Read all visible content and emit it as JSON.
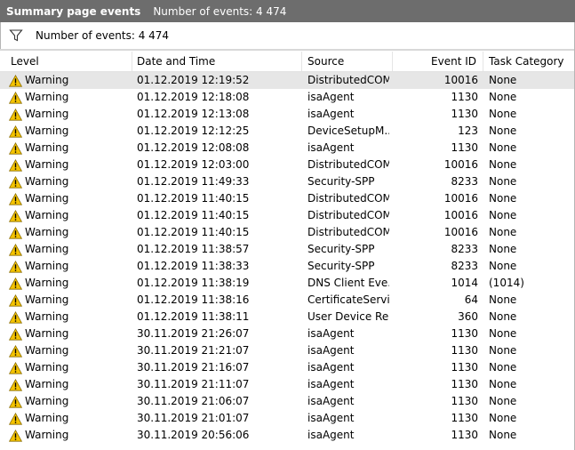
{
  "title": {
    "name": "Summary page events",
    "count": "Number of events: 4 474"
  },
  "filter": {
    "icon": "filter-icon",
    "text": "Number of events: 4 474"
  },
  "columns": {
    "level": "Level",
    "date": "Date and Time",
    "source": "Source",
    "event_id": "Event ID",
    "category": "Task Category"
  },
  "colors": {
    "titlebar": "#6d6d6d",
    "selected_row": "#e6e6e6",
    "warning_icon": "#f5c400"
  },
  "rows": [
    {
      "level": "Warning",
      "date": "01.12.2019 12:19:52",
      "source": "DistributedCOM",
      "event_id": "10016",
      "category": "None",
      "selected": true
    },
    {
      "level": "Warning",
      "date": "01.12.2019 12:18:08",
      "source": "isaAgent",
      "event_id": "1130",
      "category": "None"
    },
    {
      "level": "Warning",
      "date": "01.12.2019 12:13:08",
      "source": "isaAgent",
      "event_id": "1130",
      "category": "None"
    },
    {
      "level": "Warning",
      "date": "01.12.2019 12:12:25",
      "source": "DeviceSetupM...",
      "event_id": "123",
      "category": "None"
    },
    {
      "level": "Warning",
      "date": "01.12.2019 12:08:08",
      "source": "isaAgent",
      "event_id": "1130",
      "category": "None"
    },
    {
      "level": "Warning",
      "date": "01.12.2019 12:03:00",
      "source": "DistributedCOM",
      "event_id": "10016",
      "category": "None"
    },
    {
      "level": "Warning",
      "date": "01.12.2019 11:49:33",
      "source": "Security-SPP",
      "event_id": "8233",
      "category": "None"
    },
    {
      "level": "Warning",
      "date": "01.12.2019 11:40:15",
      "source": "DistributedCOM",
      "event_id": "10016",
      "category": "None"
    },
    {
      "level": "Warning",
      "date": "01.12.2019 11:40:15",
      "source": "DistributedCOM",
      "event_id": "10016",
      "category": "None"
    },
    {
      "level": "Warning",
      "date": "01.12.2019 11:40:15",
      "source": "DistributedCOM",
      "event_id": "10016",
      "category": "None"
    },
    {
      "level": "Warning",
      "date": "01.12.2019 11:38:57",
      "source": "Security-SPP",
      "event_id": "8233",
      "category": "None"
    },
    {
      "level": "Warning",
      "date": "01.12.2019 11:38:33",
      "source": "Security-SPP",
      "event_id": "8233",
      "category": "None"
    },
    {
      "level": "Warning",
      "date": "01.12.2019 11:38:19",
      "source": "DNS Client Eve...",
      "event_id": "1014",
      "category": "(1014)"
    },
    {
      "level": "Warning",
      "date": "01.12.2019 11:38:16",
      "source": "CertificateServi...",
      "event_id": "64",
      "category": "None"
    },
    {
      "level": "Warning",
      "date": "01.12.2019 11:38:11",
      "source": "User Device Re...",
      "event_id": "360",
      "category": "None"
    },
    {
      "level": "Warning",
      "date": "30.11.2019 21:26:07",
      "source": "isaAgent",
      "event_id": "1130",
      "category": "None"
    },
    {
      "level": "Warning",
      "date": "30.11.2019 21:21:07",
      "source": "isaAgent",
      "event_id": "1130",
      "category": "None"
    },
    {
      "level": "Warning",
      "date": "30.11.2019 21:16:07",
      "source": "isaAgent",
      "event_id": "1130",
      "category": "None"
    },
    {
      "level": "Warning",
      "date": "30.11.2019 21:11:07",
      "source": "isaAgent",
      "event_id": "1130",
      "category": "None"
    },
    {
      "level": "Warning",
      "date": "30.11.2019 21:06:07",
      "source": "isaAgent",
      "event_id": "1130",
      "category": "None"
    },
    {
      "level": "Warning",
      "date": "30.11.2019 21:01:07",
      "source": "isaAgent",
      "event_id": "1130",
      "category": "None"
    },
    {
      "level": "Warning",
      "date": "30.11.2019 20:56:06",
      "source": "isaAgent",
      "event_id": "1130",
      "category": "None"
    }
  ]
}
